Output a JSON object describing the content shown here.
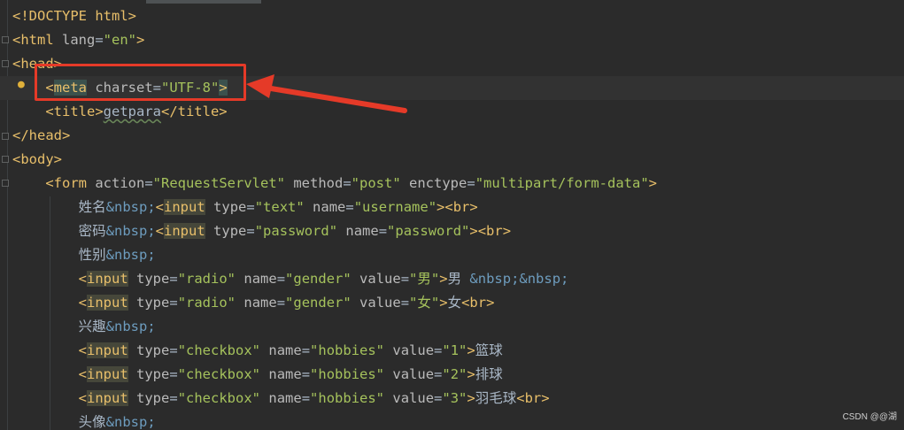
{
  "editor": {
    "lines": [
      {
        "tokens": [
          [
            "tag",
            "<!DOCTYPE html>"
          ]
        ]
      },
      {
        "tokens": [
          [
            "tag",
            "<html "
          ],
          [
            "attr",
            "lang"
          ],
          [
            "txt",
            "="
          ],
          [
            "val",
            "\"en\""
          ],
          [
            "tag",
            ">"
          ]
        ]
      },
      {
        "tokens": [
          [
            "tag",
            "<head>"
          ]
        ]
      },
      {
        "indent": 1,
        "current": true,
        "tokens": [
          [
            "tag",
            "<"
          ],
          [
            "tag-hl",
            "meta"
          ],
          [
            "txt",
            " "
          ],
          [
            "attr",
            "charset"
          ],
          [
            "txt",
            "="
          ],
          [
            "val",
            "\"UTF-8\""
          ],
          [
            "tag-hl",
            ">"
          ]
        ]
      },
      {
        "indent": 1,
        "tokens": [
          [
            "tag",
            "<title>"
          ],
          [
            "title",
            "getpara"
          ],
          [
            "tag",
            "</title>"
          ]
        ]
      },
      {
        "tokens": [
          [
            "tag",
            "</head>"
          ]
        ]
      },
      {
        "tokens": [
          [
            "tag",
            "<body>"
          ]
        ]
      },
      {
        "indent": 1,
        "tokens": [
          [
            "tag",
            "<form "
          ],
          [
            "attr",
            "action"
          ],
          [
            "txt",
            "="
          ],
          [
            "val",
            "\"RequestServlet\""
          ],
          [
            "txt",
            " "
          ],
          [
            "attr",
            "method"
          ],
          [
            "txt",
            "="
          ],
          [
            "val",
            "\"post\""
          ],
          [
            "txt",
            " "
          ],
          [
            "attr",
            "enctype"
          ],
          [
            "txt",
            "="
          ],
          [
            "val",
            "\"multipart/form-data\""
          ],
          [
            "tag",
            ">"
          ]
        ]
      },
      {
        "indent": 2,
        "tokens": [
          [
            "txt",
            "姓名"
          ],
          [
            "ent",
            "&nbsp;"
          ],
          [
            "tag",
            "<"
          ],
          [
            "tag-bg",
            "input"
          ],
          [
            "txt",
            " "
          ],
          [
            "attr",
            "type"
          ],
          [
            "txt",
            "="
          ],
          [
            "val",
            "\"text\""
          ],
          [
            "txt",
            " "
          ],
          [
            "attr",
            "name"
          ],
          [
            "txt",
            "="
          ],
          [
            "val",
            "\"username\""
          ],
          [
            "tag",
            "><br>"
          ]
        ]
      },
      {
        "indent": 2,
        "tokens": [
          [
            "txt",
            "密码"
          ],
          [
            "ent",
            "&nbsp;"
          ],
          [
            "tag",
            "<"
          ],
          [
            "tag-bg",
            "input"
          ],
          [
            "txt",
            " "
          ],
          [
            "attr",
            "type"
          ],
          [
            "txt",
            "="
          ],
          [
            "val",
            "\"password\""
          ],
          [
            "txt",
            " "
          ],
          [
            "attr",
            "name"
          ],
          [
            "txt",
            "="
          ],
          [
            "val",
            "\"password\""
          ],
          [
            "tag",
            "><br>"
          ]
        ]
      },
      {
        "indent": 2,
        "tokens": [
          [
            "txt",
            "性别"
          ],
          [
            "ent",
            "&nbsp;"
          ]
        ]
      },
      {
        "indent": 2,
        "tokens": [
          [
            "tag",
            "<"
          ],
          [
            "tag-bg",
            "input"
          ],
          [
            "txt",
            " "
          ],
          [
            "attr",
            "type"
          ],
          [
            "txt",
            "="
          ],
          [
            "val",
            "\"radio\""
          ],
          [
            "txt",
            " "
          ],
          [
            "attr",
            "name"
          ],
          [
            "txt",
            "="
          ],
          [
            "val",
            "\"gender\""
          ],
          [
            "txt",
            " "
          ],
          [
            "attr",
            "value"
          ],
          [
            "txt",
            "="
          ],
          [
            "val",
            "\"男\""
          ],
          [
            "tag",
            ">"
          ],
          [
            "txt",
            "男 "
          ],
          [
            "ent",
            "&nbsp;&nbsp;"
          ]
        ]
      },
      {
        "indent": 2,
        "tokens": [
          [
            "tag",
            "<"
          ],
          [
            "tag-bg",
            "input"
          ],
          [
            "txt",
            " "
          ],
          [
            "attr",
            "type"
          ],
          [
            "txt",
            "="
          ],
          [
            "val",
            "\"radio\""
          ],
          [
            "txt",
            " "
          ],
          [
            "attr",
            "name"
          ],
          [
            "txt",
            "="
          ],
          [
            "val",
            "\"gender\""
          ],
          [
            "txt",
            " "
          ],
          [
            "attr",
            "value"
          ],
          [
            "txt",
            "="
          ],
          [
            "val",
            "\"女\""
          ],
          [
            "tag",
            ">"
          ],
          [
            "txt",
            "女"
          ],
          [
            "tag",
            "<br>"
          ]
        ]
      },
      {
        "indent": 2,
        "tokens": [
          [
            "txt",
            "兴趣"
          ],
          [
            "ent",
            "&nbsp;"
          ]
        ]
      },
      {
        "indent": 2,
        "tokens": [
          [
            "tag",
            "<"
          ],
          [
            "tag-bg",
            "input"
          ],
          [
            "txt",
            " "
          ],
          [
            "attr",
            "type"
          ],
          [
            "txt",
            "="
          ],
          [
            "val",
            "\"checkbox\""
          ],
          [
            "txt",
            " "
          ],
          [
            "attr",
            "name"
          ],
          [
            "txt",
            "="
          ],
          [
            "val",
            "\"hobbies\""
          ],
          [
            "txt",
            " "
          ],
          [
            "attr",
            "value"
          ],
          [
            "txt",
            "="
          ],
          [
            "val",
            "\"1\""
          ],
          [
            "tag",
            ">"
          ],
          [
            "txt",
            "篮球"
          ]
        ]
      },
      {
        "indent": 2,
        "tokens": [
          [
            "tag",
            "<"
          ],
          [
            "tag-bg",
            "input"
          ],
          [
            "txt",
            " "
          ],
          [
            "attr",
            "type"
          ],
          [
            "txt",
            "="
          ],
          [
            "val",
            "\"checkbox\""
          ],
          [
            "txt",
            " "
          ],
          [
            "attr",
            "name"
          ],
          [
            "txt",
            "="
          ],
          [
            "val",
            "\"hobbies\""
          ],
          [
            "txt",
            " "
          ],
          [
            "attr",
            "value"
          ],
          [
            "txt",
            "="
          ],
          [
            "val",
            "\"2\""
          ],
          [
            "tag",
            ">"
          ],
          [
            "txt",
            "排球"
          ]
        ]
      },
      {
        "indent": 2,
        "tokens": [
          [
            "tag",
            "<"
          ],
          [
            "tag-bg",
            "input"
          ],
          [
            "txt",
            " "
          ],
          [
            "attr",
            "type"
          ],
          [
            "txt",
            "="
          ],
          [
            "val",
            "\"checkbox\""
          ],
          [
            "txt",
            " "
          ],
          [
            "attr",
            "name"
          ],
          [
            "txt",
            "="
          ],
          [
            "val",
            "\"hobbies\""
          ],
          [
            "txt",
            " "
          ],
          [
            "attr",
            "value"
          ],
          [
            "txt",
            "="
          ],
          [
            "val",
            "\"3\""
          ],
          [
            "tag",
            ">"
          ],
          [
            "txt",
            "羽毛球"
          ],
          [
            "tag",
            "<br>"
          ]
        ]
      },
      {
        "indent": 2,
        "tokens": [
          [
            "txt",
            "头像"
          ],
          [
            "ent",
            "&nbsp;"
          ]
        ]
      }
    ]
  },
  "annotation": {
    "box_color": "#e53a28",
    "arrow_color": "#e53a28"
  },
  "watermark": "CSDN @@湖",
  "colors": {
    "background": "#2b2b2b",
    "tag": "#e8bf6a",
    "attribute": "#bababa",
    "value": "#a5c25c",
    "entity": "#6d9cbe",
    "text": "#a9b7c6"
  }
}
